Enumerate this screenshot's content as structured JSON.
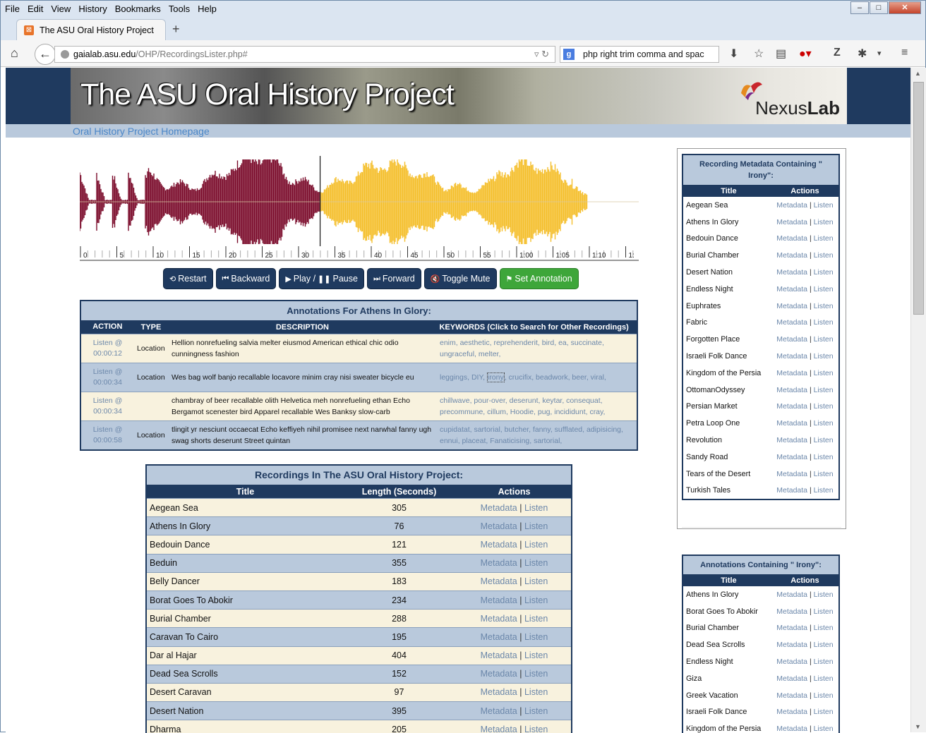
{
  "browser": {
    "menu": [
      "File",
      "Edit",
      "View",
      "History",
      "Bookmarks",
      "Tools",
      "Help"
    ],
    "tab_title": "The ASU Oral History Project",
    "url_host": "gaialab.asu.edu",
    "url_path": "/OHP/RecordingsLister.php#",
    "search_text": "php right trim comma and spac"
  },
  "banner": {
    "title": "The ASU Oral History Project",
    "logo_text_a": "Nexus",
    "logo_text_b": "Lab",
    "homepage_link": "Oral History Project Homepage"
  },
  "waveform": {
    "played_color": "#7a0a2a",
    "remaining_color": "#f5be2a",
    "played_fraction": 0.43,
    "ticks": [
      "0",
      "5",
      "10",
      "15",
      "20",
      "25",
      "30",
      "35",
      "40",
      "45",
      "50",
      "55",
      "1:00",
      "1:05",
      "1:10",
      "1:"
    ]
  },
  "controls": {
    "restart": "Restart",
    "backward": "Backward",
    "play": "Play /",
    "pause": "Pause",
    "forward": "Forward",
    "mute": "Toggle Mute",
    "annotate": "Set Annotation"
  },
  "annotations": {
    "caption": "Annotations For Athens In Glory:",
    "headers": [
      "ACTION",
      "TYPE",
      "DESCRIPTION",
      "KEYWORDS (Click to Search for Other Recordings)"
    ],
    "rows": [
      {
        "action": "Listen @",
        "time": "00:00:12",
        "type": "Location",
        "desc": "Hellion nonrefueling salvia melter eiusmod American ethical chic odio cunningness fashion",
        "keywords": "enim, aesthetic, reprehenderit, bird, ea, succinate, ungraceful, melter,"
      },
      {
        "action": "Listen @",
        "time": "00:00:34",
        "type": "Location",
        "desc": "Wes bag wolf banjo recallable locavore minim cray nisi sweater bicycle eu",
        "kw_a": "leggings, DIY, ",
        "kw_hl": "irony",
        "kw_b": ", crucifix, beadwork, beer, viral,"
      },
      {
        "action": "Listen @",
        "time": "00:00:34",
        "type": "",
        "desc": "chambray of beer recallable olith Helvetica meh nonrefueling ethan Echo Bergamot scenester bird Apparel recallable Wes Banksy slow-carb",
        "keywords": "chillwave, pour-over, deserunt, keytar, consequat, precommune, cillum, Hoodie, pug, incididunt, cray,"
      },
      {
        "action": "Listen @",
        "time": "00:00:58",
        "type": "Location",
        "desc": "tlingit yr nesciunt occaecat Echo keffiyeh nihil promisee next narwhal fanny ugh swag shorts deserunt Street quintan",
        "keywords": "cupidatat, sartorial, butcher, fanny, sufflated, adipisicing, ennui, placeat, Fanaticising, sartorial,"
      }
    ]
  },
  "recordings": {
    "caption": "Recordings In The ASU Oral History Project:",
    "headers": [
      "Title",
      "Length (Seconds)",
      "Actions"
    ],
    "metadata_label": "Metadata",
    "listen_label": "Listen",
    "sep": "|",
    "rows": [
      {
        "title": "Aegean Sea",
        "length": "305"
      },
      {
        "title": "Athens In Glory",
        "length": "76"
      },
      {
        "title": "Bedouin Dance",
        "length": "121"
      },
      {
        "title": "Beduin",
        "length": "355"
      },
      {
        "title": "Belly Dancer",
        "length": "183"
      },
      {
        "title": "Borat Goes To Abokir",
        "length": "234"
      },
      {
        "title": "Burial Chamber",
        "length": "288"
      },
      {
        "title": "Caravan To Cairo",
        "length": "195"
      },
      {
        "title": "Dar al Hajar",
        "length": "404"
      },
      {
        "title": "Dead Sea Scrolls",
        "length": "152"
      },
      {
        "title": "Desert Caravan",
        "length": "97"
      },
      {
        "title": "Desert Nation",
        "length": "395"
      },
      {
        "title": "Dharma",
        "length": "205"
      }
    ]
  },
  "metadata_panel": {
    "caption": "Recording Metadata Containing \" Irony\":",
    "headers": [
      "Title",
      "Actions"
    ],
    "rows": [
      "Aegean Sea",
      "Athens In Glory",
      "Bedouin Dance",
      "Burial Chamber",
      "Desert Nation",
      "Endless Night",
      "Euphrates",
      "Fabric",
      "Forgotten Place",
      "Israeli Folk Dance",
      "Kingdom of the Persia",
      "OttomanOdyssey",
      "Persian Market",
      "Petra Loop One",
      "Revolution",
      "Sandy Road",
      "Tears of the Desert",
      "Turkish Tales"
    ]
  },
  "annotations_panel": {
    "caption": "Annotations Containing \" Irony\":",
    "headers": [
      "Title",
      "Actions"
    ],
    "rows": [
      "Athens In Glory",
      "Borat Goes To Abokir",
      "Burial Chamber",
      "Dead Sea Scrolls",
      "Endless Night",
      "Giza",
      "Greek Vacation",
      "Israeli Folk Dance",
      "Kingdom of the Persia"
    ]
  }
}
